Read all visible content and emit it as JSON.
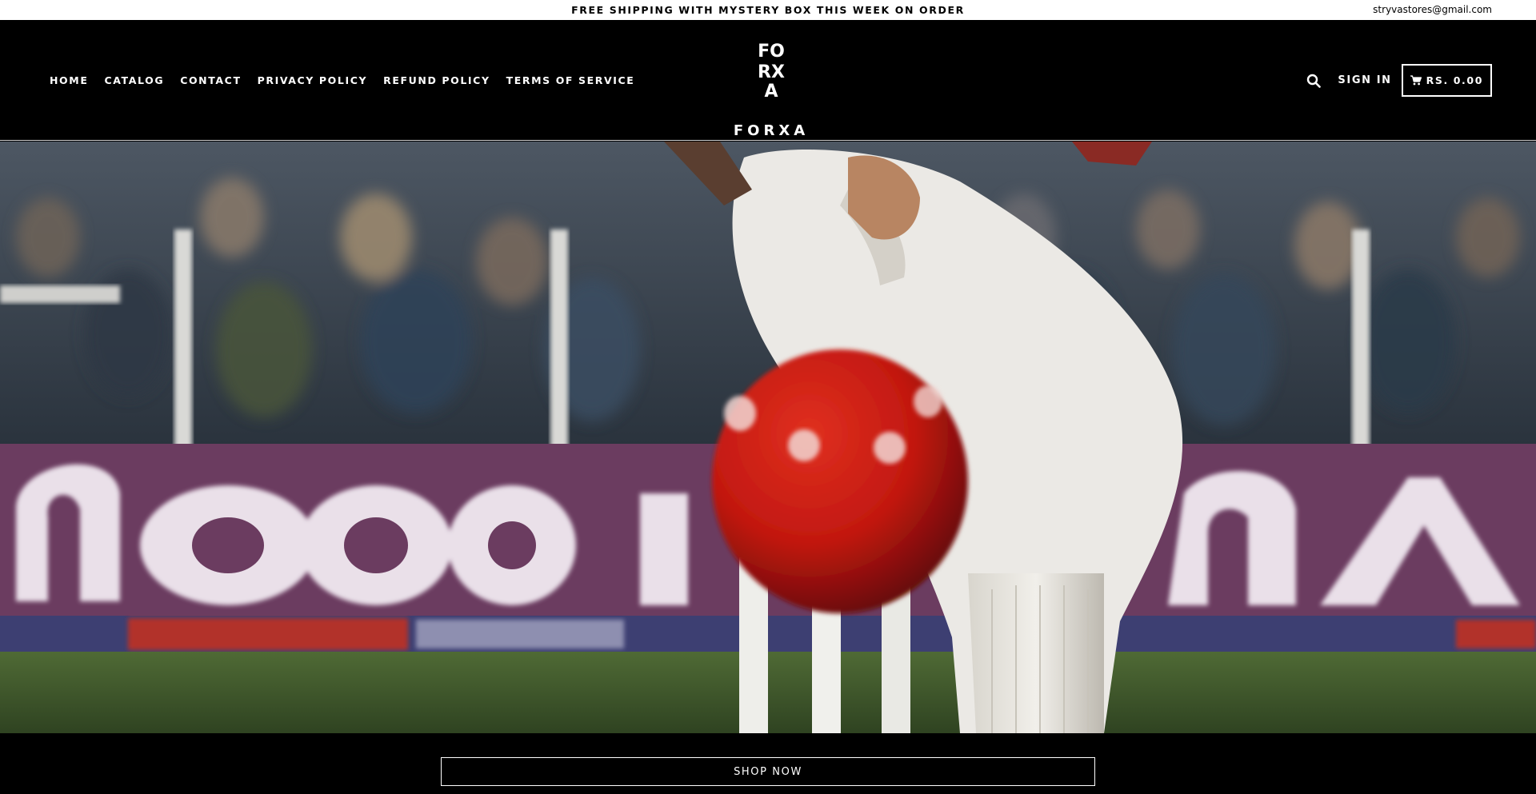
{
  "announcement": {
    "text": "FREE SHIPPING WITH MYSTERY BOX THIS WEEK ON ORDER",
    "email": "stryvastores@gmail.com"
  },
  "nav": {
    "items": [
      {
        "label": "HOME"
      },
      {
        "label": "CATALOG"
      },
      {
        "label": "CONTACT"
      },
      {
        "label": "PRIVACY POLICY"
      },
      {
        "label": "REFUND POLICY"
      },
      {
        "label": "TERMS OF SERVICE"
      }
    ]
  },
  "logo": {
    "wordmark": "FORXA",
    "monogram": [
      "FO",
      "RX",
      "A"
    ]
  },
  "header": {
    "search_icon": "search-icon",
    "signin_label": "SIGN IN",
    "cart_icon": "shopping-cart-icon",
    "cart_label": "RS. 0.00"
  },
  "hero": {
    "scene": "cricket-batsman-and-red-ball"
  },
  "cta": {
    "label": "SHOP NOW"
  },
  "colors": {
    "background": "#000000",
    "announcement_bg": "#ffffff",
    "text_light": "#ffffff",
    "ball_red": "#c21810"
  }
}
